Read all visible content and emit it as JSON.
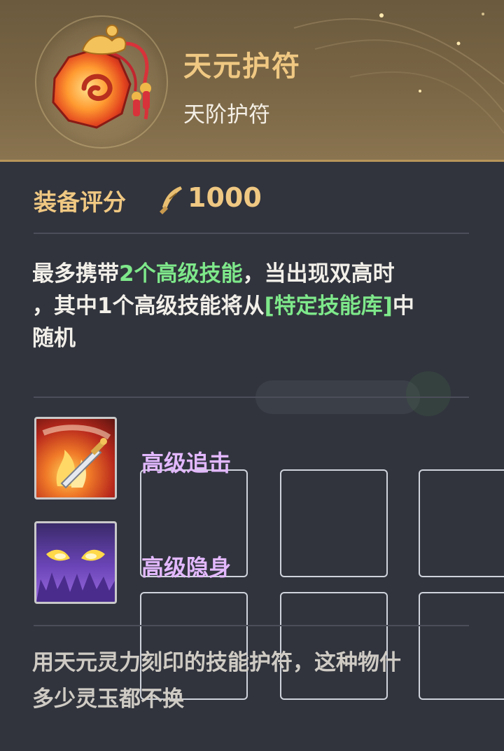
{
  "item": {
    "name": "天元护符",
    "grade": "天阶护符",
    "icon": "amulet-pouch-icon"
  },
  "rating": {
    "label": "装备评分",
    "icon": "feather-quill-icon",
    "value": "1000"
  },
  "description": {
    "line1_a": "最多携带",
    "line1_hl": "2个高级技能",
    "line1_b": "，当出现双高时",
    "line2_a": "，其中1个高级技能将从",
    "line2_hl": "[特定技能库]",
    "line2_b": "中",
    "line3": "随机"
  },
  "skills": [
    {
      "name": "高级追击",
      "icon": "flaming-sword-icon"
    },
    {
      "name": "高级隐身",
      "icon": "glowing-eyes-icon"
    }
  ],
  "lore": {
    "line1": "用天元灵力刻印的技能护符，这种物什",
    "line2": "多少灵玉都不换"
  },
  "colors": {
    "title_gold": "#f0c882",
    "highlight_green": "#7ee88a",
    "skill_purple": "#e3b8ff",
    "panel_bg": "#31343d"
  }
}
